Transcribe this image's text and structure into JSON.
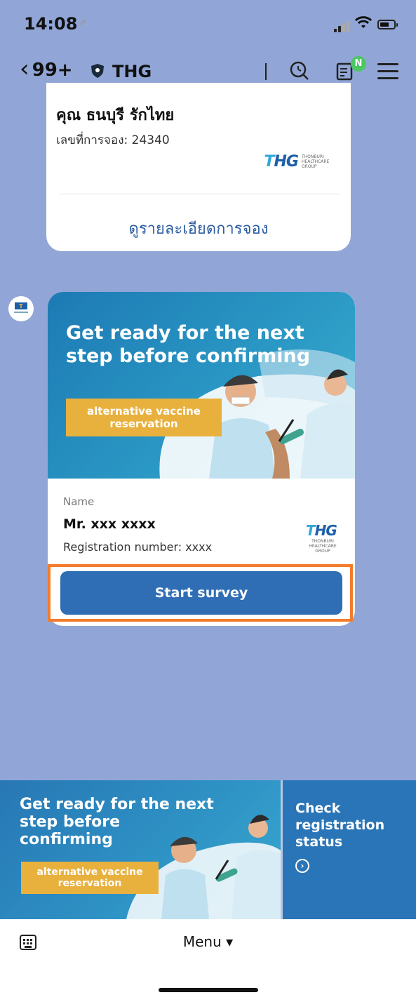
{
  "status_bar": {
    "time": "14:08"
  },
  "nav": {
    "back_count": "99+",
    "chat_name": "THG",
    "notes_badge": "N"
  },
  "booking_card": {
    "name": "คุณ ธนบุรี รักไทย",
    "booking_number": "เลขที่การจอง: 24340",
    "view_details_link": "ดูรายละเอียดการจอง",
    "logo_text": "THG",
    "logo_sub": "THONBURI HEALTHCARE GROUP"
  },
  "survey_card": {
    "banner_title": "Get ready for the next step before confirming",
    "banner_tag": "alternative vaccine reservation",
    "name_label": "Name",
    "person_name": "Mr. xxx xxxx",
    "registration": "Registration number: xxxx",
    "button_label": "Start survey"
  },
  "rich_menu": {
    "left_title": "Get ready for the next step before confirming",
    "left_tag": "alternative vaccine reservation",
    "right_title": "Check registration status",
    "right_icon": "chevron-right-circle-icon"
  },
  "bottom_bar": {
    "menu_label": "Menu ▾"
  },
  "colors": {
    "chat_background": "#91a6d6",
    "primary_button": "#2f6eb4",
    "highlight": "#f47c2c",
    "tag": "#e8b13e",
    "badge": "#4cc764"
  }
}
